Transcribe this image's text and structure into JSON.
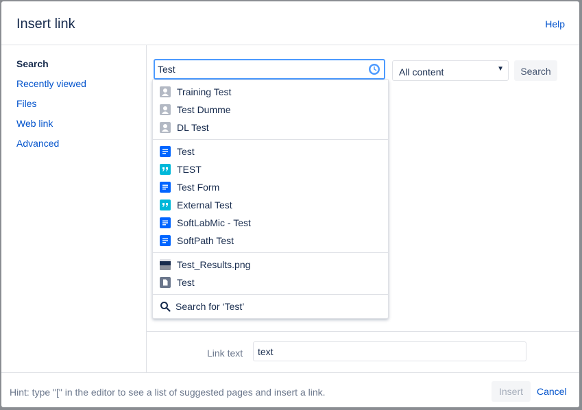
{
  "dialog": {
    "title": "Insert link",
    "help_label": "Help"
  },
  "sidebar": {
    "items": [
      {
        "label": "Search",
        "active": true
      },
      {
        "label": "Recently viewed"
      },
      {
        "label": "Files"
      },
      {
        "label": "Web link"
      },
      {
        "label": "Advanced"
      }
    ]
  },
  "search": {
    "value": "Test",
    "scope_selected": "All content",
    "button_label": "Search"
  },
  "results": {
    "people": [
      "Training Test",
      "Test Dumme",
      "DL Test"
    ],
    "content": [
      {
        "label": "Test",
        "icon": "page-icon"
      },
      {
        "label": "TEST",
        "icon": "blog-icon"
      },
      {
        "label": "Test Form",
        "icon": "page-icon"
      },
      {
        "label": "External Test",
        "icon": "blog-icon"
      },
      {
        "label": "SoftLabMic - Test",
        "icon": "page-icon"
      },
      {
        "label": "SoftPath Test",
        "icon": "page-icon"
      }
    ],
    "files": [
      {
        "label": "Test_Results.png",
        "icon": "image-icon"
      },
      {
        "label": "Test",
        "icon": "file-icon"
      }
    ],
    "search_for": "Search for ‘Test’"
  },
  "link_text": {
    "label": "Link text",
    "value": "text"
  },
  "footer": {
    "hint": "Hint: type \"[\" in the editor to see a list of suggested pages and insert a link.",
    "insert_label": "Insert",
    "cancel_label": "Cancel"
  },
  "colors": {
    "accent": "#0052cc",
    "focus_border": "#4c9aff",
    "page_icon": "#0065ff",
    "blog_icon": "#00b8d9"
  }
}
